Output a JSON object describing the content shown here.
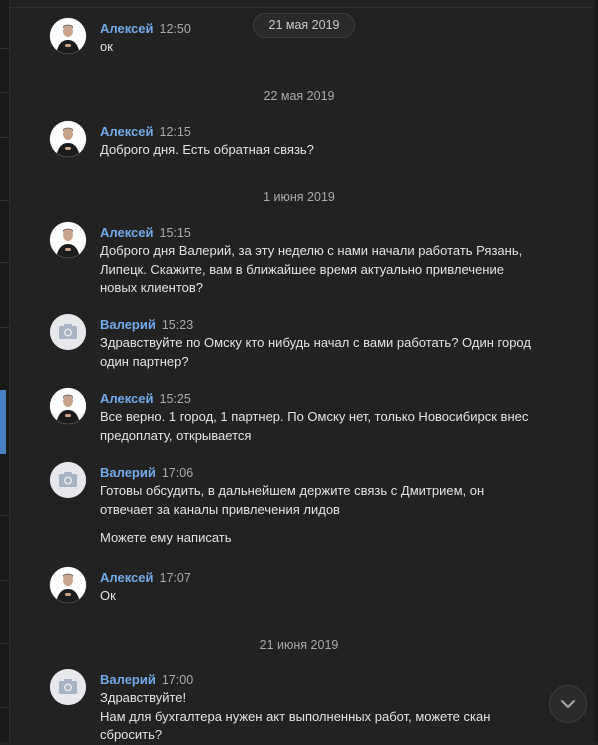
{
  "floating_date": "21 мая 2019",
  "dates": {
    "d1": "22 мая 2019",
    "d2": "1 июня 2019",
    "d3": "21 июня 2019"
  },
  "messages": [
    {
      "author": "Алексей",
      "time": "12:50",
      "avatar": "user-photo",
      "text": "ок"
    },
    {
      "author": "Алексей",
      "time": "12:15",
      "avatar": "user-photo",
      "text": "Доброго дня. Есть обратная связь?"
    },
    {
      "author": "Алексей",
      "time": "15:15",
      "avatar": "user-photo",
      "text": "Доброго дня Валерий, за эту неделю с нами начали работать Рязань, Липецк. Скажите, вам в ближайшее время актуально привлечение новых клиентов?"
    },
    {
      "author": "Валерий",
      "time": "15:23",
      "avatar": "camera-icon",
      "text": "Здравствуйте по Омску кто нибудь начал с вами работать? Один город один партнер?"
    },
    {
      "author": "Алексей",
      "time": "15:25",
      "avatar": "user-photo",
      "text": "Все верно. 1 город, 1 партнер. По Омску нет, только Новосибирск внес предоплату, открывается"
    },
    {
      "author": "Валерий",
      "time": "17:06",
      "avatar": "camera-icon",
      "text": "Готовы обсудить, в дальнейшем держите связь с Дмитрием, он отвечает за каналы привлечения лидов",
      "extra": "Можете ему написать"
    },
    {
      "author": "Алексей",
      "time": "17:07",
      "avatar": "user-photo",
      "text": "Ок"
    },
    {
      "author": "Валерий",
      "time": "17:00",
      "avatar": "camera-icon",
      "text_lines": [
        "Здравствуйте!",
        "Нам для бухгалтера нужен акт выполненных работ, можете скан сбросить?"
      ]
    }
  ],
  "icons": {
    "scroll": "chevron-down-icon"
  },
  "colors": {
    "background": "#222222",
    "author": "#71aaeb",
    "text": "#e1e3e6",
    "muted": "#a9aaac"
  }
}
